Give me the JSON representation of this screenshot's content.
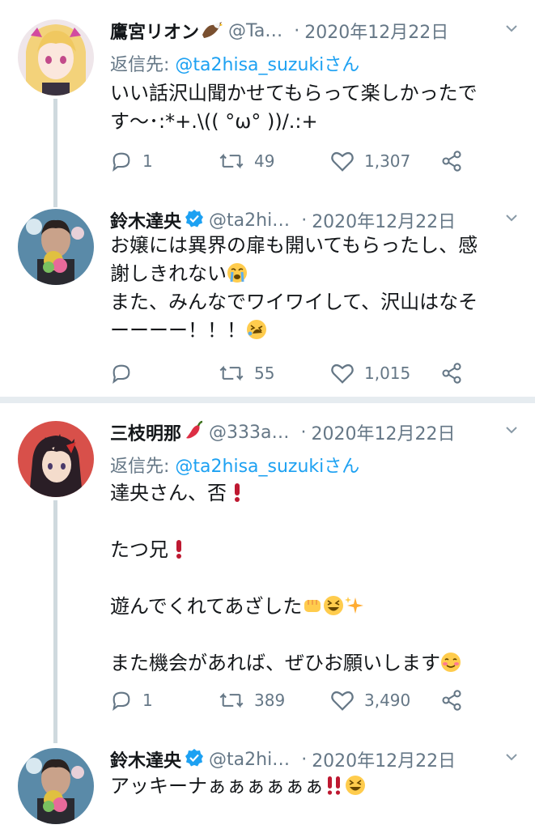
{
  "tweets": [
    {
      "name": "鷹宮リオン",
      "handle": "@Ta…",
      "date": "2020年12月22日",
      "reply_label": "返信先:",
      "reply_to": "@ta2hisa_suzukiさん",
      "text": "いい話沢山聞かせてもらって楽しかったです〜･:*+.\\(( °ω° ))/.:+",
      "replies": "1",
      "retweets": "49",
      "likes": "1,307"
    },
    {
      "name": "鈴木達央",
      "handle": "@ta2hi…",
      "date": "2020年12月22日",
      "text_lines": [
        "お嬢には異界の扉も開いてもらったし、感",
        "謝しきれない",
        "また、みんなでワイワイして、沢山はなそ",
        "ーーーー！！！"
      ],
      "replies": "",
      "retweets": "55",
      "likes": "1,015"
    },
    {
      "name": "三枝明那",
      "handle": "@333a…",
      "date": "2020年12月22日",
      "reply_label": "返信先:",
      "reply_to": "@ta2hisa_suzukiさん",
      "text_lines": [
        "達央さん、否",
        "たつ兄",
        "遊んでくれてあざした",
        "また機会があれば、ぜひお願いします"
      ],
      "replies": "1",
      "retweets": "389",
      "likes": "3,490"
    },
    {
      "name": "鈴木達央",
      "handle": "@ta2hi…",
      "date": "2020年12月22日",
      "text": "アッキーナぁぁぁぁぁぁ"
    }
  ],
  "colors": {
    "accent": "#1da1f2",
    "secondary_text": "#657786",
    "primary_text": "#14171a",
    "thread_line": "#cfd9de"
  },
  "icons": [
    "reply-icon",
    "retweet-icon",
    "like-icon",
    "share-icon",
    "chevron-down-icon",
    "verified-icon"
  ]
}
